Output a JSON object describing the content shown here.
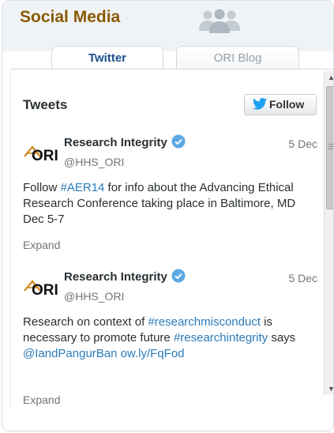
{
  "widget": {
    "title": "Social Media",
    "header_icon": "people-group-icon",
    "tabs": [
      {
        "label": "Twitter",
        "active": true
      },
      {
        "label": "ORI Blog",
        "active": false
      }
    ]
  },
  "feed": {
    "heading": "Tweets",
    "follow_label": "Follow",
    "follow_icon": "twitter-bird-icon",
    "colors": {
      "link": "#2b7bb9",
      "verified": "#1da1f2",
      "title": "#8a5a00"
    },
    "tweets": [
      {
        "avatar_text": "ORI",
        "author": "Research Integrity",
        "handle": "@HHS_ORI",
        "date": "5 Dec",
        "body_parts": [
          {
            "text": "Follow "
          },
          {
            "text": "#AER14",
            "link": true
          },
          {
            "text": " for info about the Advancing Ethical Research Conference taking place in Baltimore, MD Dec 5-7"
          }
        ],
        "expand_label": "Expand"
      },
      {
        "avatar_text": "ORI",
        "author": "Research Integrity",
        "handle": "@HHS_ORI",
        "date": "5 Dec",
        "body_parts": [
          {
            "text": "Research on context of "
          },
          {
            "text": "#researchmisconduct",
            "link": true
          },
          {
            "text": " is necessary to promote future "
          },
          {
            "text": "#researchintegrity",
            "link": true
          },
          {
            "text": " says "
          },
          {
            "text": "@IandPangurBan",
            "link": true
          },
          {
            "text": " "
          },
          {
            "text": "ow.ly/FqFod",
            "link": true
          }
        ],
        "expand_label": "Expand"
      }
    ]
  }
}
